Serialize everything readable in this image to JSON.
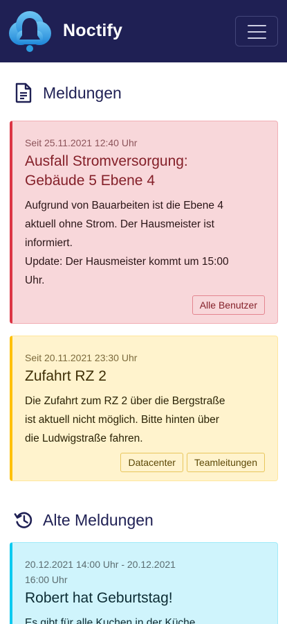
{
  "app": {
    "title": "Noctify"
  },
  "sections": {
    "current": "Meldungen",
    "old": "Alte Meldungen"
  },
  "notices": [
    {
      "time": "Seit 25.11.2021 12:40 Uhr",
      "title_line1": "Ausfall Stromversorgung:",
      "title_line2": "Gebäude 5 Ebene 4",
      "body": [
        "Aufgrund von Bauarbeiten ist die Ebene 4",
        "aktuell ohne Strom. Der Hausmeister ist",
        "informiert.",
        "Update: Der Hausmeister kommt um 15:00",
        "Uhr."
      ],
      "tags": [
        "Alle Benutzer"
      ],
      "status_color": "#dc3545"
    },
    {
      "time": "Seit 20.11.2021 23:30 Uhr",
      "title_line1": "Zufahrt RZ 2",
      "body": [
        "Die Zufahrt zum RZ 2 über die Bergstraße",
        "ist aktuell nicht möglich. Bitte hinten über",
        "die Ludwigstraße fahren."
      ],
      "tags": [
        "Datacenter",
        "Teamleitungen"
      ],
      "status_color": "#ffc107"
    }
  ],
  "old_notices": [
    {
      "time_line1": "20.12.2021 14:00 Uhr - 20.12.2021",
      "time_line2": "16:00 Uhr",
      "title": "Robert hat Geburtstag!",
      "body": [
        "Es gibt für alle Kuchen in der Küche"
      ],
      "status_color": "#0dcaf0"
    }
  ],
  "colors": {
    "navbar": "#1f2054",
    "accent": "#2b9be0"
  },
  "icons": {
    "logo": "bell-cloud-logo",
    "menu": "hamburger-menu-icon",
    "current": "document-icon",
    "old": "history-icon"
  }
}
